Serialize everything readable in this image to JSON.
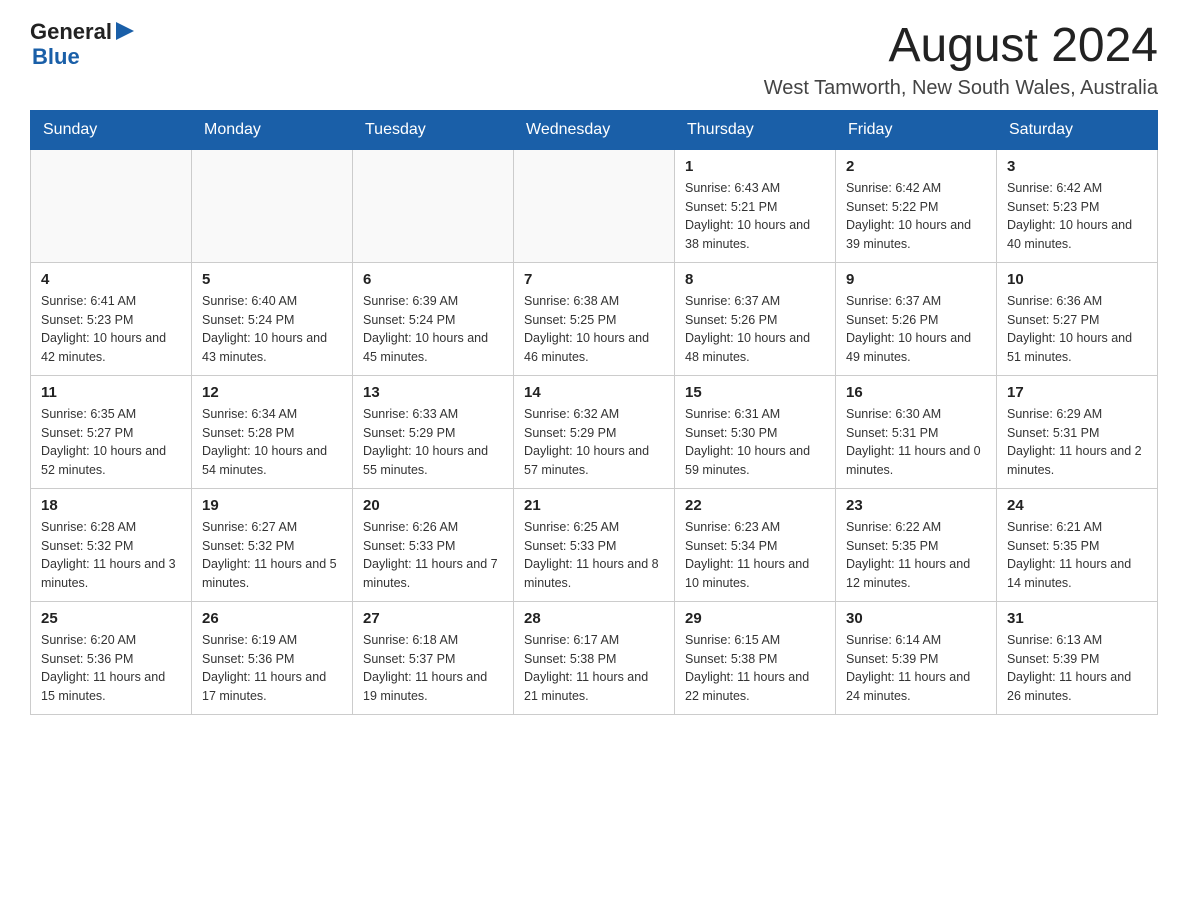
{
  "header": {
    "logo_general": "General",
    "logo_blue": "Blue",
    "month_title": "August 2024",
    "location": "West Tamworth, New South Wales, Australia"
  },
  "days_of_week": [
    "Sunday",
    "Monday",
    "Tuesday",
    "Wednesday",
    "Thursday",
    "Friday",
    "Saturday"
  ],
  "weeks": [
    [
      {
        "day": "",
        "sunrise": "",
        "sunset": "",
        "daylight": ""
      },
      {
        "day": "",
        "sunrise": "",
        "sunset": "",
        "daylight": ""
      },
      {
        "day": "",
        "sunrise": "",
        "sunset": "",
        "daylight": ""
      },
      {
        "day": "",
        "sunrise": "",
        "sunset": "",
        "daylight": ""
      },
      {
        "day": "1",
        "sunrise": "Sunrise: 6:43 AM",
        "sunset": "Sunset: 5:21 PM",
        "daylight": "Daylight: 10 hours and 38 minutes."
      },
      {
        "day": "2",
        "sunrise": "Sunrise: 6:42 AM",
        "sunset": "Sunset: 5:22 PM",
        "daylight": "Daylight: 10 hours and 39 minutes."
      },
      {
        "day": "3",
        "sunrise": "Sunrise: 6:42 AM",
        "sunset": "Sunset: 5:23 PM",
        "daylight": "Daylight: 10 hours and 40 minutes."
      }
    ],
    [
      {
        "day": "4",
        "sunrise": "Sunrise: 6:41 AM",
        "sunset": "Sunset: 5:23 PM",
        "daylight": "Daylight: 10 hours and 42 minutes."
      },
      {
        "day": "5",
        "sunrise": "Sunrise: 6:40 AM",
        "sunset": "Sunset: 5:24 PM",
        "daylight": "Daylight: 10 hours and 43 minutes."
      },
      {
        "day": "6",
        "sunrise": "Sunrise: 6:39 AM",
        "sunset": "Sunset: 5:24 PM",
        "daylight": "Daylight: 10 hours and 45 minutes."
      },
      {
        "day": "7",
        "sunrise": "Sunrise: 6:38 AM",
        "sunset": "Sunset: 5:25 PM",
        "daylight": "Daylight: 10 hours and 46 minutes."
      },
      {
        "day": "8",
        "sunrise": "Sunrise: 6:37 AM",
        "sunset": "Sunset: 5:26 PM",
        "daylight": "Daylight: 10 hours and 48 minutes."
      },
      {
        "day": "9",
        "sunrise": "Sunrise: 6:37 AM",
        "sunset": "Sunset: 5:26 PM",
        "daylight": "Daylight: 10 hours and 49 minutes."
      },
      {
        "day": "10",
        "sunrise": "Sunrise: 6:36 AM",
        "sunset": "Sunset: 5:27 PM",
        "daylight": "Daylight: 10 hours and 51 minutes."
      }
    ],
    [
      {
        "day": "11",
        "sunrise": "Sunrise: 6:35 AM",
        "sunset": "Sunset: 5:27 PM",
        "daylight": "Daylight: 10 hours and 52 minutes."
      },
      {
        "day": "12",
        "sunrise": "Sunrise: 6:34 AM",
        "sunset": "Sunset: 5:28 PM",
        "daylight": "Daylight: 10 hours and 54 minutes."
      },
      {
        "day": "13",
        "sunrise": "Sunrise: 6:33 AM",
        "sunset": "Sunset: 5:29 PM",
        "daylight": "Daylight: 10 hours and 55 minutes."
      },
      {
        "day": "14",
        "sunrise": "Sunrise: 6:32 AM",
        "sunset": "Sunset: 5:29 PM",
        "daylight": "Daylight: 10 hours and 57 minutes."
      },
      {
        "day": "15",
        "sunrise": "Sunrise: 6:31 AM",
        "sunset": "Sunset: 5:30 PM",
        "daylight": "Daylight: 10 hours and 59 minutes."
      },
      {
        "day": "16",
        "sunrise": "Sunrise: 6:30 AM",
        "sunset": "Sunset: 5:31 PM",
        "daylight": "Daylight: 11 hours and 0 minutes."
      },
      {
        "day": "17",
        "sunrise": "Sunrise: 6:29 AM",
        "sunset": "Sunset: 5:31 PM",
        "daylight": "Daylight: 11 hours and 2 minutes."
      }
    ],
    [
      {
        "day": "18",
        "sunrise": "Sunrise: 6:28 AM",
        "sunset": "Sunset: 5:32 PM",
        "daylight": "Daylight: 11 hours and 3 minutes."
      },
      {
        "day": "19",
        "sunrise": "Sunrise: 6:27 AM",
        "sunset": "Sunset: 5:32 PM",
        "daylight": "Daylight: 11 hours and 5 minutes."
      },
      {
        "day": "20",
        "sunrise": "Sunrise: 6:26 AM",
        "sunset": "Sunset: 5:33 PM",
        "daylight": "Daylight: 11 hours and 7 minutes."
      },
      {
        "day": "21",
        "sunrise": "Sunrise: 6:25 AM",
        "sunset": "Sunset: 5:33 PM",
        "daylight": "Daylight: 11 hours and 8 minutes."
      },
      {
        "day": "22",
        "sunrise": "Sunrise: 6:23 AM",
        "sunset": "Sunset: 5:34 PM",
        "daylight": "Daylight: 11 hours and 10 minutes."
      },
      {
        "day": "23",
        "sunrise": "Sunrise: 6:22 AM",
        "sunset": "Sunset: 5:35 PM",
        "daylight": "Daylight: 11 hours and 12 minutes."
      },
      {
        "day": "24",
        "sunrise": "Sunrise: 6:21 AM",
        "sunset": "Sunset: 5:35 PM",
        "daylight": "Daylight: 11 hours and 14 minutes."
      }
    ],
    [
      {
        "day": "25",
        "sunrise": "Sunrise: 6:20 AM",
        "sunset": "Sunset: 5:36 PM",
        "daylight": "Daylight: 11 hours and 15 minutes."
      },
      {
        "day": "26",
        "sunrise": "Sunrise: 6:19 AM",
        "sunset": "Sunset: 5:36 PM",
        "daylight": "Daylight: 11 hours and 17 minutes."
      },
      {
        "day": "27",
        "sunrise": "Sunrise: 6:18 AM",
        "sunset": "Sunset: 5:37 PM",
        "daylight": "Daylight: 11 hours and 19 minutes."
      },
      {
        "day": "28",
        "sunrise": "Sunrise: 6:17 AM",
        "sunset": "Sunset: 5:38 PM",
        "daylight": "Daylight: 11 hours and 21 minutes."
      },
      {
        "day": "29",
        "sunrise": "Sunrise: 6:15 AM",
        "sunset": "Sunset: 5:38 PM",
        "daylight": "Daylight: 11 hours and 22 minutes."
      },
      {
        "day": "30",
        "sunrise": "Sunrise: 6:14 AM",
        "sunset": "Sunset: 5:39 PM",
        "daylight": "Daylight: 11 hours and 24 minutes."
      },
      {
        "day": "31",
        "sunrise": "Sunrise: 6:13 AM",
        "sunset": "Sunset: 5:39 PM",
        "daylight": "Daylight: 11 hours and 26 minutes."
      }
    ]
  ]
}
